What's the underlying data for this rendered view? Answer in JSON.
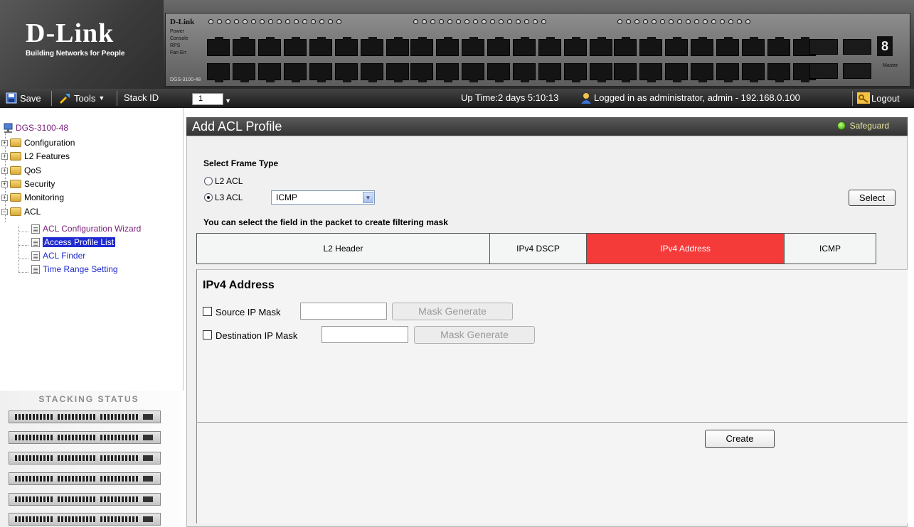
{
  "banner": {
    "logo_title": "D-Link",
    "logo_subtitle": "Building Networks for People",
    "panel_brand": "D-Link",
    "led_labels": [
      "Power",
      "Console",
      "RPS",
      "Fan Err"
    ],
    "model_label": "DGS-3100-48",
    "seven_segment": "8",
    "master_label": "Master"
  },
  "toolbar": {
    "save_label": "Save",
    "tools_label": "Tools",
    "stack_id_label": "Stack ID",
    "stack_id_value": "1",
    "uptime": "Up Time:2 days 5:10:13",
    "logged_in": "Logged in as administrator, admin - 192.168.0.100",
    "logout_label": "Logout"
  },
  "sidebar": {
    "root": "DGS-3100-48",
    "folders": [
      "Configuration",
      "L2 Features",
      "QoS",
      "Security",
      "Monitoring",
      "ACL"
    ],
    "acl_items": [
      "ACL Configuration Wizard",
      "Access Profile List",
      "ACL Finder",
      "Time Range Setting"
    ],
    "selected_item": "Access Profile List"
  },
  "stacking": {
    "title": "Stacking Status",
    "unit_count": 6
  },
  "page": {
    "title": "Add ACL Profile",
    "safeguard_label": "Safeguard",
    "select_frame_type": "Select Frame Type",
    "l2_acl_label": "L2 ACL",
    "l3_acl_label": "L3 ACL",
    "l3_selected": true,
    "l3_type_value": "ICMP",
    "select_button": "Select",
    "hint": "You can select the field in the packet to create filtering mask",
    "tabs": [
      "L2 Header",
      "IPv4 DSCP",
      "IPv4 Address",
      "ICMP"
    ],
    "active_tab": "IPv4 Address",
    "field_section_title": "IPv4 Address",
    "source_ip_label": "Source IP Mask",
    "destination_ip_label": "Destination IP Mask",
    "source_ip_value": "",
    "destination_ip_value": "",
    "mask_generate_label": "Mask Generate",
    "create_button": "Create"
  },
  "colors": {
    "active_tab": "#f53a3a",
    "header_bar": "#3f3f3f",
    "selected_tree_item": "#1f2bd0",
    "safeguard_led": "#3da10a"
  }
}
